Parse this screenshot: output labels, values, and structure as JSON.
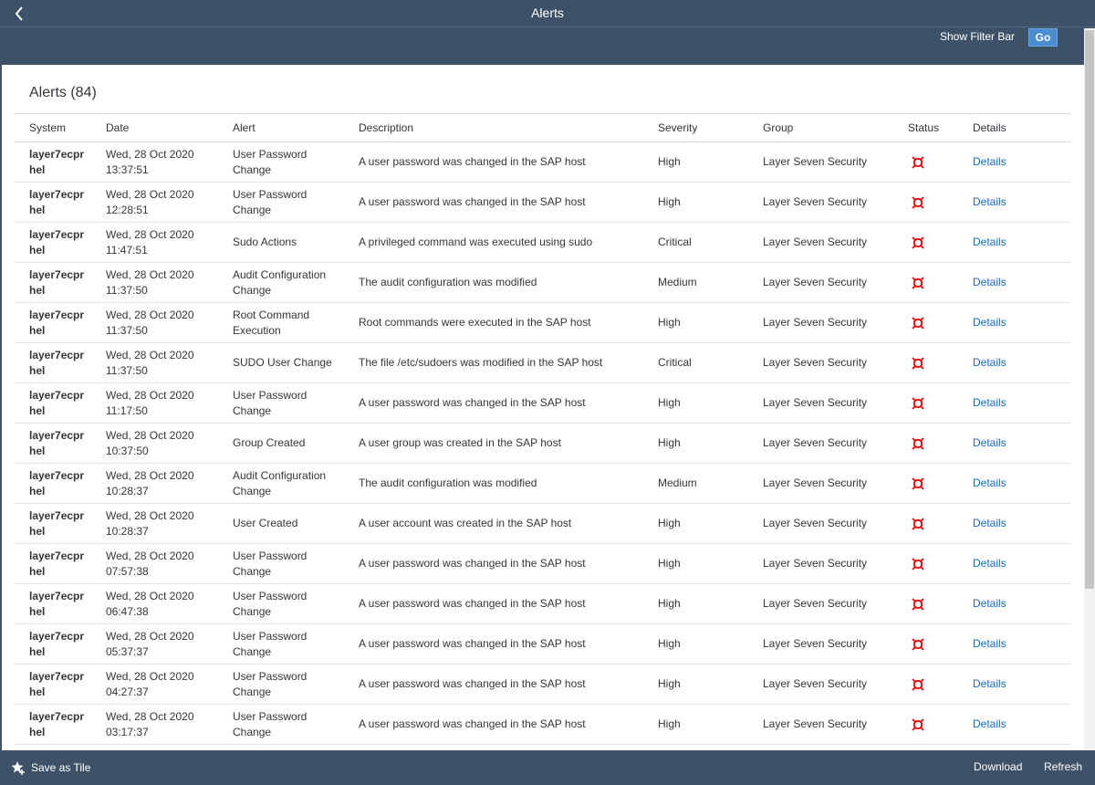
{
  "header": {
    "title": "Alerts",
    "back_icon": "chevron-left-icon"
  },
  "filter_bar": {
    "show_filter_label": "Show Filter Bar",
    "go_label": "Go"
  },
  "table": {
    "title": "Alerts (84)",
    "columns": [
      "System",
      "Date",
      "Alert",
      "Description",
      "Severity",
      "Group",
      "Status",
      "Details"
    ],
    "status_color": "#e00000",
    "rows": [
      {
        "system": "layer7ecpr hel",
        "date": "Wed, 28 Oct 2020 13:37:51",
        "alert": "User Password Change",
        "description": "A user password was changed in the SAP host",
        "severity": "High",
        "group": "Layer Seven Security",
        "details": "Details"
      },
      {
        "system": "layer7ecpr hel",
        "date": "Wed, 28 Oct 2020 12:28:51",
        "alert": "User Password Change",
        "description": "A user password was changed in the SAP host",
        "severity": "High",
        "group": "Layer Seven Security",
        "details": "Details"
      },
      {
        "system": "layer7ecpr hel",
        "date": "Wed, 28 Oct 2020 11:47:51",
        "alert": "Sudo Actions",
        "description": "A privileged command was executed using sudo",
        "severity": "Critical",
        "group": "Layer Seven Security",
        "details": "Details"
      },
      {
        "system": "layer7ecpr hel",
        "date": "Wed, 28 Oct 2020 11:37:50",
        "alert": "Audit Configuration Change",
        "description": "The audit configuration was modified",
        "severity": "Medium",
        "group": "Layer Seven Security",
        "details": "Details"
      },
      {
        "system": "layer7ecpr hel",
        "date": "Wed, 28 Oct 2020 11:37:50",
        "alert": "Root Command Execution",
        "description": "Root commands were executed in the SAP host",
        "severity": "High",
        "group": "Layer Seven Security",
        "details": "Details"
      },
      {
        "system": "layer7ecpr hel",
        "date": "Wed, 28 Oct 2020 11:37:50",
        "alert": "SUDO User Change",
        "description": "The file /etc/sudoers was modified in the SAP host",
        "severity": "Critical",
        "group": "Layer Seven Security",
        "details": "Details"
      },
      {
        "system": "layer7ecpr hel",
        "date": "Wed, 28 Oct 2020 11:17:50",
        "alert": "User Password Change",
        "description": "A user password was changed in the SAP host",
        "severity": "High",
        "group": "Layer Seven Security",
        "details": "Details"
      },
      {
        "system": "layer7ecpr hel",
        "date": "Wed, 28 Oct 2020 10:37:50",
        "alert": "Group Created",
        "description": "A user group was created in the SAP host",
        "severity": "High",
        "group": "Layer Seven Security",
        "details": "Details"
      },
      {
        "system": "layer7ecpr hel",
        "date": "Wed, 28 Oct 2020 10:28:37",
        "alert": "Audit Configuration Change",
        "description": "The audit configuration was modified",
        "severity": "Medium",
        "group": "Layer Seven Security",
        "details": "Details"
      },
      {
        "system": "layer7ecpr hel",
        "date": "Wed, 28 Oct 2020 10:28:37",
        "alert": "User Created",
        "description": "A user account was created in the SAP host",
        "severity": "High",
        "group": "Layer Seven Security",
        "details": "Details"
      },
      {
        "system": "layer7ecpr hel",
        "date": "Wed, 28 Oct 2020 07:57:38",
        "alert": "User Password Change",
        "description": "A user password was changed in the SAP host",
        "severity": "High",
        "group": "Layer Seven Security",
        "details": "Details"
      },
      {
        "system": "layer7ecpr hel",
        "date": "Wed, 28 Oct 2020 06:47:38",
        "alert": "User Password Change",
        "description": "A user password was changed in the SAP host",
        "severity": "High",
        "group": "Layer Seven Security",
        "details": "Details"
      },
      {
        "system": "layer7ecpr hel",
        "date": "Wed, 28 Oct 2020 05:37:37",
        "alert": "User Password Change",
        "description": "A user password was changed in the SAP host",
        "severity": "High",
        "group": "Layer Seven Security",
        "details": "Details"
      },
      {
        "system": "layer7ecpr hel",
        "date": "Wed, 28 Oct 2020 04:27:37",
        "alert": "User Password Change",
        "description": "A user password was changed in the SAP host",
        "severity": "High",
        "group": "Layer Seven Security",
        "details": "Details"
      },
      {
        "system": "layer7ecpr hel",
        "date": "Wed, 28 Oct 2020 03:17:37",
        "alert": "User Password Change",
        "description": "A user password was changed in the SAP host",
        "severity": "High",
        "group": "Layer Seven Security",
        "details": "Details"
      }
    ]
  },
  "footer": {
    "save_tile_label": "Save as Tile",
    "save_tile_icon": "star-add-icon",
    "download_label": "Download",
    "refresh_label": "Refresh"
  }
}
